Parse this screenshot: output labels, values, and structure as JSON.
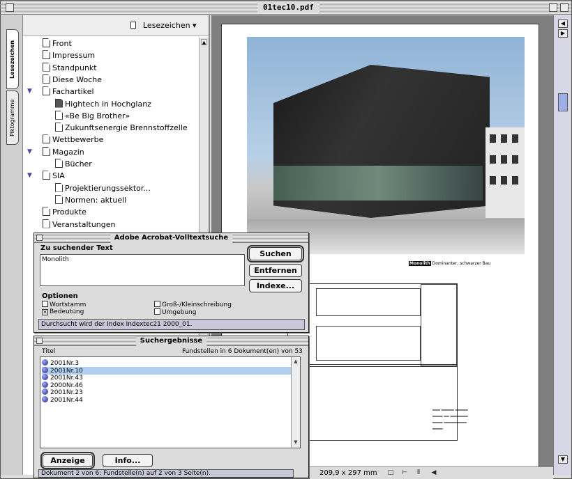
{
  "window": {
    "title": "01tec10.pdf"
  },
  "sidetabs": {
    "bookmarks": "Lesezeichen",
    "thumbnails": "Piktogramme"
  },
  "bookmarks_panel": {
    "menu_label": "Lesezeichen ▾",
    "items": [
      {
        "label": "Front",
        "level": 0,
        "expanded": null
      },
      {
        "label": "Impressum",
        "level": 0,
        "expanded": null
      },
      {
        "label": "Standpunkt",
        "level": 0,
        "expanded": null
      },
      {
        "label": "Diese Woche",
        "level": 0,
        "expanded": null
      },
      {
        "label": "Fachartikel",
        "level": 0,
        "expanded": true
      },
      {
        "label": "Hightech in Hochglanz",
        "level": 1,
        "expanded": null,
        "selected": true
      },
      {
        "label": "«Be Big Brother»",
        "level": 1,
        "expanded": null
      },
      {
        "label": "Zukunftsenergie Brennstoffzelle",
        "level": 1,
        "expanded": null
      },
      {
        "label": "Wettbewerbe",
        "level": 0,
        "expanded": null
      },
      {
        "label": "Magazin",
        "level": 0,
        "expanded": true
      },
      {
        "label": "Bücher",
        "level": 1,
        "expanded": null
      },
      {
        "label": "SIA",
        "level": 0,
        "expanded": true
      },
      {
        "label": "Projektierungssektor...",
        "level": 1,
        "expanded": null
      },
      {
        "label": "Normen: aktuell",
        "level": 1,
        "expanded": null
      },
      {
        "label": "Produkte",
        "level": 0,
        "expanded": null
      },
      {
        "label": "Veranstaltungen",
        "level": 0,
        "expanded": null
      }
    ]
  },
  "search_dialog": {
    "title": "Adobe Acrobat-Volltextsuche",
    "search_label": "Zu suchender Text",
    "search_value": "Monolith",
    "buttons": {
      "search": "Suchen",
      "remove": "Entfernen",
      "indexes": "Indexe..."
    },
    "options_label": "Optionen",
    "options": [
      {
        "label": "Wortstamm",
        "checked": false
      },
      {
        "label": "Bedeutung",
        "checked": true
      },
      {
        "label": "Groß-/Kleinschreibung",
        "checked": false
      },
      {
        "label": "Umgebung",
        "checked": false
      }
    ],
    "status": "Durchsucht wird der Index Indextec21 2000_01."
  },
  "results_dialog": {
    "title": "Suchergebnisse",
    "col_title": "Titel",
    "summary": "Fundstellen in 6 Dokument(en) von 53",
    "items": [
      {
        "label": "2001Nr.3",
        "selected": false
      },
      {
        "label": "2001Nr.10",
        "selected": true
      },
      {
        "label": "2001Nr.43",
        "selected": false
      },
      {
        "label": "2000Nr.46",
        "selected": false
      },
      {
        "label": "2001Nr.23",
        "selected": false
      },
      {
        "label": "2001Nr.44",
        "selected": false
      }
    ],
    "buttons": {
      "show": "Anzeige",
      "info": "Info..."
    },
    "status": "Dokument 2 von 6: Fundstelle(n) auf 2 von 3 Seite(n)."
  },
  "document": {
    "caption1_highlight": "Monolith",
    "caption1_rest": "Dominanter, schwarzer Bau"
  },
  "statusbar": {
    "page_size": "209,9 x 297 mm"
  }
}
